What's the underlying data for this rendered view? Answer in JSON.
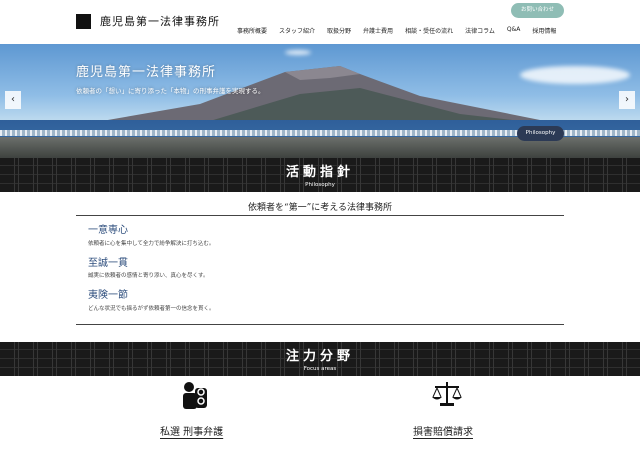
{
  "header": {
    "logo_text": "鹿児島第一法律事務所",
    "contact_label": "お問い合わせ",
    "nav": [
      "事務所概要",
      "スタッフ紹介",
      "取扱分野",
      "弁護士費用",
      "相談・受任の流れ",
      "法律コラム",
      "Q&A",
      "採用情報"
    ]
  },
  "hero": {
    "title": "鹿児島第一法律事務所",
    "subtitle": "依頼者の「想い」に寄り添った「本物」の刑事弁護を実現する。",
    "badge": "Philosophy",
    "prev_icon": "chevron-left-icon",
    "next_icon": "chevron-right-icon"
  },
  "philosophy": {
    "title": "活動指針",
    "subtitle": "Philosophy",
    "heading": "依頼者を“第一”に考える法律事務所",
    "items": [
      {
        "title": "一意専心",
        "desc": "依頼者に心を集中して全力で紛争解決に打ち込む。"
      },
      {
        "title": "至誠一貫",
        "desc": "誠実に依頼者の感情と寄り添い、真心を尽くす。"
      },
      {
        "title": "夷険一節",
        "desc": "どんな状況でも揺るがず依頼者第一の信念を貫く。"
      }
    ]
  },
  "focus": {
    "title": "注力分野",
    "subtitle": "Focus areas",
    "areas": [
      {
        "label": "私選 刑事弁護",
        "icon": "handcuffs-person-icon"
      },
      {
        "label": "損害賠償請求",
        "icon": "scales-icon"
      }
    ]
  }
}
